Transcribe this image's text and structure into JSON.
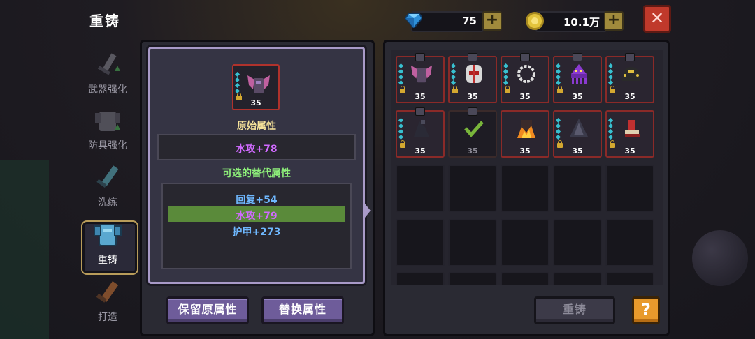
{
  "header": {
    "title": "重铸"
  },
  "currency": {
    "gems": {
      "icon": "diamond-icon",
      "value": "75"
    },
    "gold": {
      "icon": "coin-icon",
      "value": "10.1万"
    }
  },
  "sidebar": {
    "items": [
      {
        "label": "武器强化",
        "icon": "sword-icon"
      },
      {
        "label": "防具强化",
        "icon": "armor-icon"
      },
      {
        "label": "洗练",
        "icon": "blade-icon"
      },
      {
        "label": "重铸",
        "icon": "armor-blue-icon",
        "active": true
      },
      {
        "label": "打造",
        "icon": "hammer-icon"
      }
    ]
  },
  "selected_item": {
    "level": "35",
    "icon": "bat-wing-armor-icon"
  },
  "original_attr": {
    "title": "原始属性",
    "value": "水攻+78"
  },
  "alternatives": {
    "title": "可选的替代属性",
    "options": [
      {
        "text": "回复+54",
        "color": "#6fb8ff"
      },
      {
        "text": "水攻+79",
        "color": "#d06aff",
        "selected": true
      },
      {
        "text": "护甲+273",
        "color": "#6fb8ff"
      }
    ]
  },
  "buttons": {
    "keep": "保留原属性",
    "replace": "替换属性",
    "recast": "重铸",
    "help": "?"
  },
  "inventory": {
    "items": [
      {
        "level": "35",
        "icon": "bat-wing-armor-icon"
      },
      {
        "level": "35",
        "icon": "skull-mask-icon"
      },
      {
        "level": "35",
        "icon": "chain-ring-icon"
      },
      {
        "level": "35",
        "icon": "purple-squid-icon"
      },
      {
        "level": "35",
        "icon": "black-crown-icon"
      },
      {
        "level": "35",
        "icon": "dark-bird-icon"
      },
      {
        "level": "35",
        "icon": "checkmark-icon",
        "selected": true
      },
      {
        "level": "35",
        "icon": "fire-armor-icon"
      },
      {
        "level": "35",
        "icon": "dark-cloak-icon"
      },
      {
        "level": "35",
        "icon": "red-boot-icon"
      }
    ],
    "empty_cells": 15
  }
}
